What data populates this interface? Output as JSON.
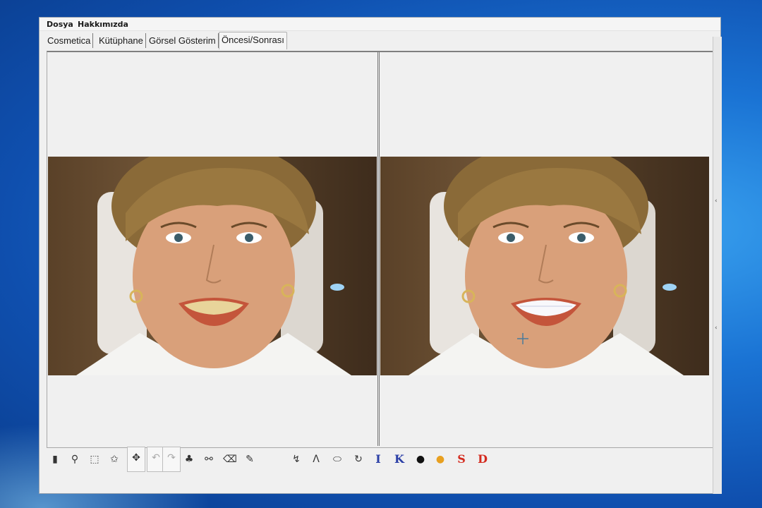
{
  "menu": {
    "items": [
      "Dosya",
      "Hakkımızda"
    ]
  },
  "tabs": [
    {
      "label": "Cosmetica",
      "active": false
    },
    {
      "label": "Kütüphane",
      "active": false
    },
    {
      "label": "Görsel Gösterim",
      "active": false
    },
    {
      "label": "Öncesi/Sonrası",
      "active": true
    }
  ],
  "panes": {
    "before": {
      "photo": "woman-smiling-before-icon"
    },
    "after": {
      "photo": "woman-smiling-after-icon"
    }
  },
  "toolbar": {
    "tools": [
      {
        "name": "pointer-bottle-tool-icon",
        "glyph": "▮"
      },
      {
        "name": "zoom-tool-icon",
        "glyph": "⚲"
      },
      {
        "name": "rect-select-tool-icon",
        "glyph": "⬚"
      },
      {
        "name": "lasso-select-tool-icon",
        "glyph": "✩"
      },
      {
        "name": "move-tool-icon",
        "glyph": "✥"
      },
      {
        "name": "undo-icon",
        "glyph": "↶"
      },
      {
        "name": "redo-icon",
        "glyph": "↷"
      },
      {
        "name": "clone-tool-icon",
        "glyph": "♣"
      },
      {
        "name": "clone-alt-tool-icon",
        "glyph": "⚯"
      },
      {
        "name": "eraser-tool-icon",
        "glyph": "⌫"
      },
      {
        "name": "dropper-tool-icon",
        "glyph": "✎"
      },
      {
        "name": "curve-tool-icon",
        "glyph": "↯"
      },
      {
        "name": "angle-tool-icon",
        "glyph": "Λ"
      },
      {
        "name": "pill-tool-icon",
        "glyph": "⬭"
      },
      {
        "name": "rotate-tool-icon",
        "glyph": "↻"
      },
      {
        "name": "text-i-tool",
        "glyph": "I"
      },
      {
        "name": "text-k-tool",
        "glyph": "K"
      },
      {
        "name": "black-dot-tool-icon",
        "glyph": "●"
      },
      {
        "name": "orange-dot-tool-icon",
        "glyph": "●"
      },
      {
        "name": "text-s-tool",
        "glyph": "S"
      },
      {
        "name": "text-d-tool",
        "glyph": "D"
      }
    ]
  },
  "colors": {
    "desktop_blue": "#1a73d4",
    "text_blue": "#2b3fa6",
    "text_red": "#d42a1e",
    "orange": "#e8a020"
  }
}
